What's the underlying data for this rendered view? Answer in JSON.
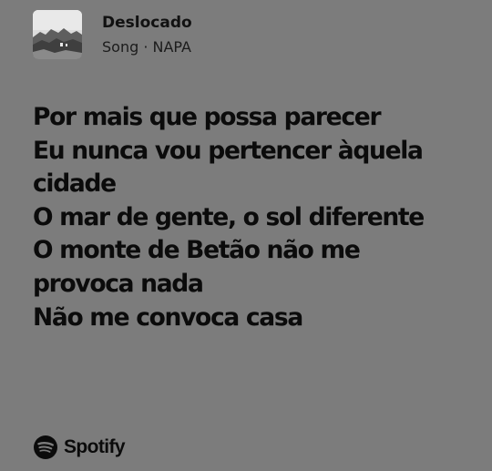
{
  "track": {
    "title": "Deslocado",
    "subtitle": "Song · NAPA",
    "artwork_icon": "album-artwork-landscape"
  },
  "lyrics": {
    "lines": [
      "Por mais que possa parecer",
      "Eu nunca vou pertencer àquela",
      "cidade",
      "O mar de gente, o sol diferente",
      "O monte de Betão não me",
      "provoca nada",
      "Não me convoca casa"
    ]
  },
  "brand": {
    "icon": "spotify-icon",
    "name": "Spotify"
  },
  "colors": {
    "background": "#7c7c7c",
    "text": "#0b0b0b"
  }
}
